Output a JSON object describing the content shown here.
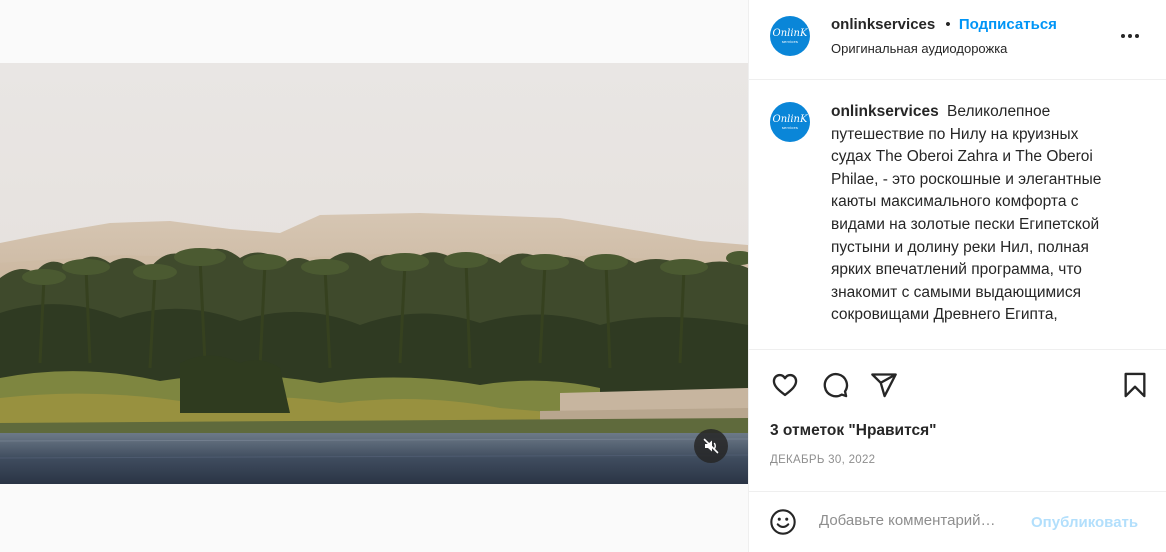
{
  "post": {
    "author": "onlinkservices",
    "avatar_brand": "OnlinK",
    "avatar_sub": "services",
    "follow_label": "Подписаться",
    "separator": "•",
    "audio": "Оригинальная аудиодорожка",
    "caption": "Великолепное путешествие по Нилу на круизных судах The Oberoi Zahra и The Oberoi Philae, - это роскошные и элегантные каюты максимального комфорта с видами на золотые пески Египетской пустыни и долину реки Нил, полная ярких впечатлений программа, что знакомит с самыми выдающимися сокровищами Древнего Египта,",
    "likes": "3 отметок \"Нравится\"",
    "date": "ДЕКАБРЬ 30, 2022"
  },
  "comment": {
    "placeholder": "Добавьте комментарий…",
    "publish_label": "Опубликовать"
  },
  "icons": {
    "more": "more-options-icon",
    "like": "heart-icon",
    "comment": "comment-icon",
    "share": "send-icon",
    "save": "bookmark-icon",
    "mute": "speaker-muted-icon",
    "emoji": "emoji-icon"
  },
  "colors": {
    "accent": "#0095f6",
    "avatar": "#0a86d8",
    "publish_disabled": "#b2dffc",
    "muted_text": "#8e8e8e"
  }
}
